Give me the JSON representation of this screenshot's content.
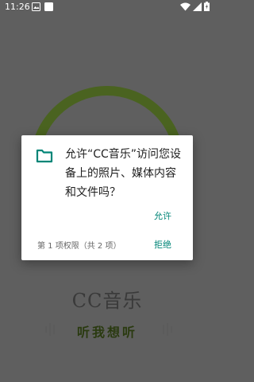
{
  "status_bar": {
    "time": "11:26",
    "left_icons": [
      "image-icon",
      "notification-icon"
    ],
    "right_icons": [
      "wifi-icon",
      "signal-icon",
      "battery-icon"
    ]
  },
  "background_app": {
    "title": "CC音乐",
    "slogan": "听我想听",
    "logo_color": "#4a6320"
  },
  "permission_dialog": {
    "icon": "folder-icon",
    "message": "允许“CC音乐”访问您设备上的照片、媒体内容和文件吗？",
    "allow_label": "允许",
    "counter": "第 1 项权限（共 2 项）",
    "deny_label": "拒绝",
    "accent_color": "#008577"
  }
}
